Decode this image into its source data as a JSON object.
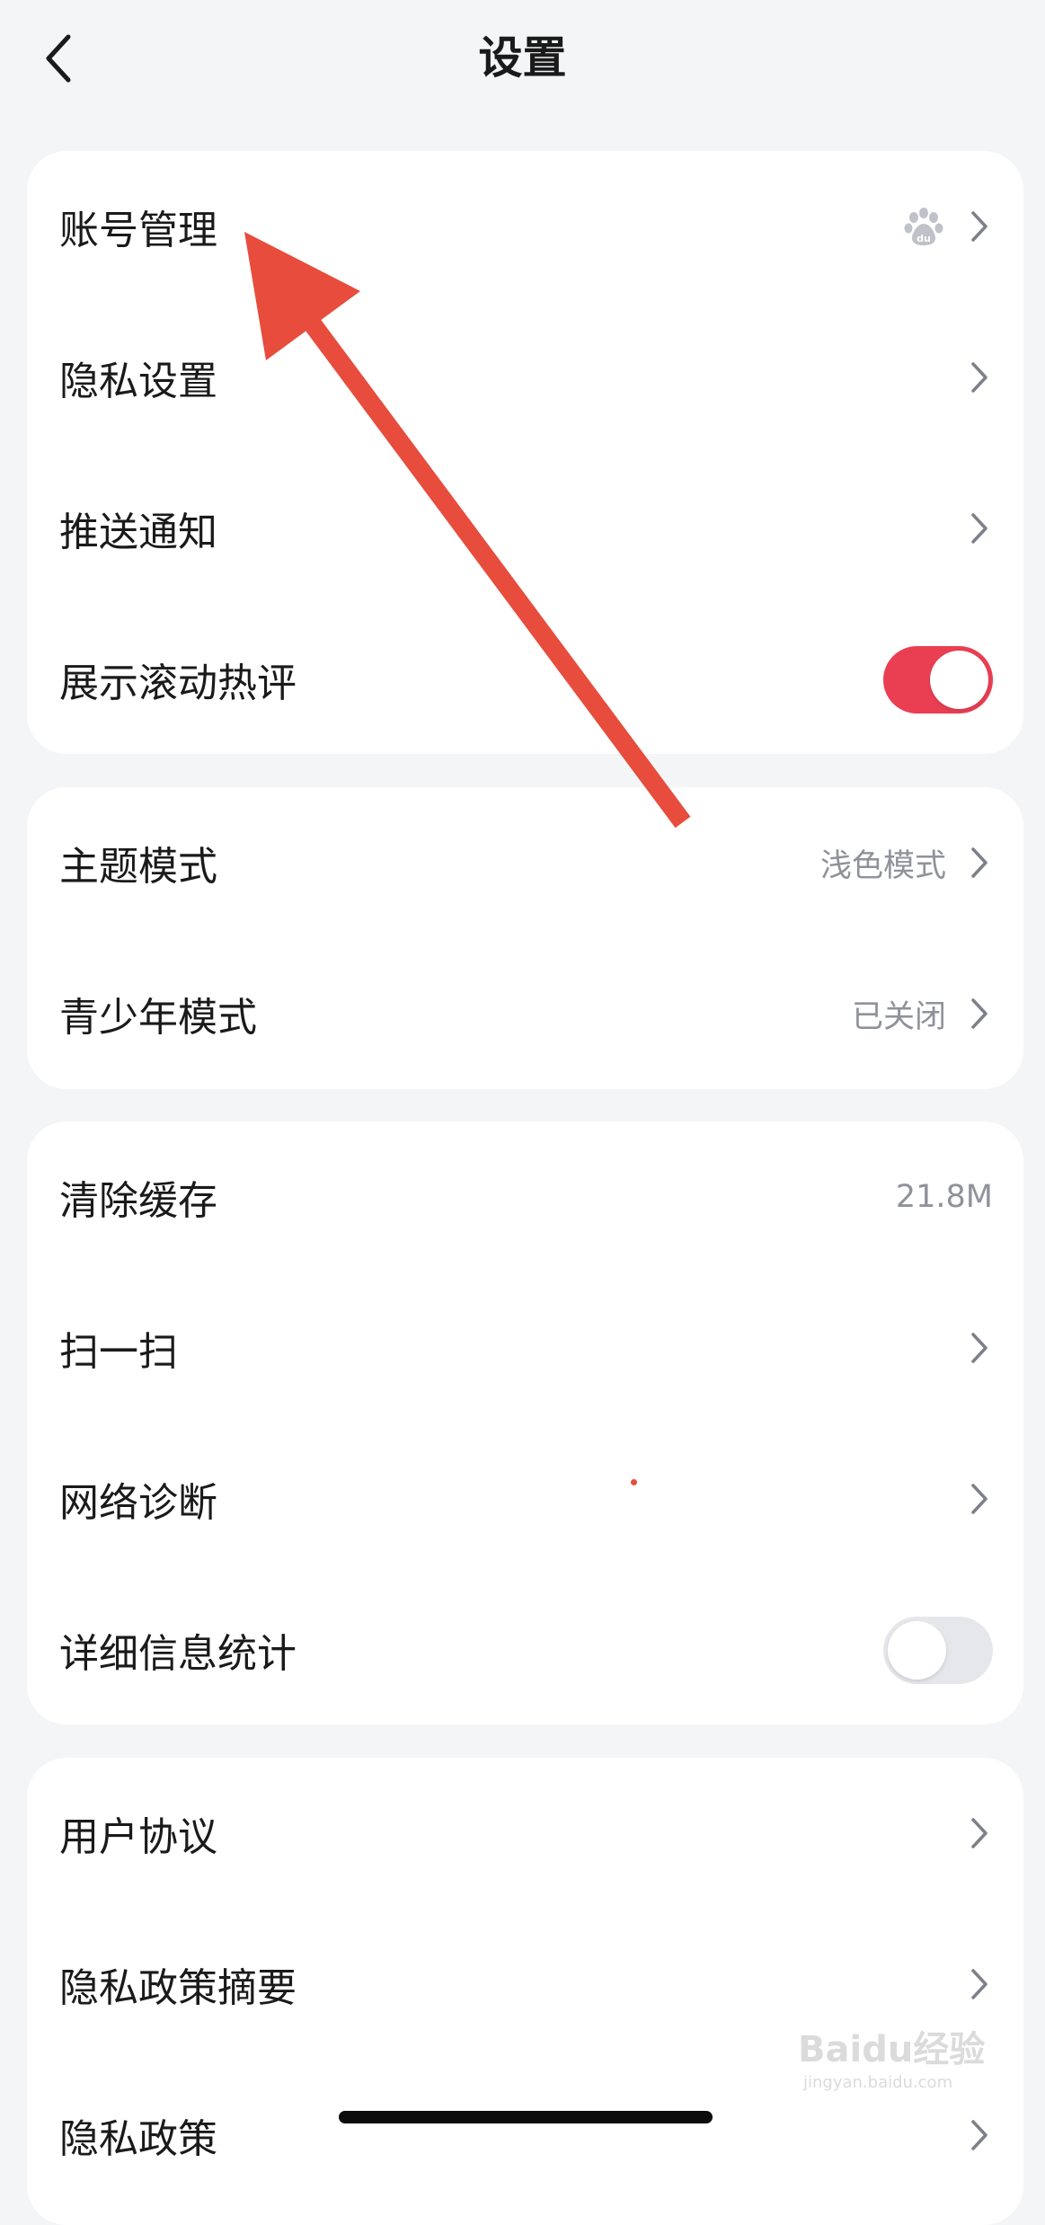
{
  "header": {
    "title": "设置"
  },
  "cards": [
    {
      "rows": [
        {
          "label": "账号管理",
          "value": "",
          "control": "chevron",
          "icon": "baidu-paw-icon"
        },
        {
          "label": "隐私设置",
          "value": "",
          "control": "chevron"
        },
        {
          "label": "推送通知",
          "value": "",
          "control": "chevron"
        },
        {
          "label": "展示滚动热评",
          "value": "",
          "control": "toggle",
          "toggle_on": true
        }
      ]
    },
    {
      "rows": [
        {
          "label": "主题模式",
          "value": "浅色模式",
          "control": "chevron"
        },
        {
          "label": "青少年模式",
          "value": "已关闭",
          "control": "chevron"
        }
      ]
    },
    {
      "rows": [
        {
          "label": "清除缓存",
          "value": "21.8M",
          "control": "none"
        },
        {
          "label": "扫一扫",
          "value": "",
          "control": "chevron"
        },
        {
          "label": "网络诊断",
          "value": "",
          "control": "chevron"
        },
        {
          "label": "详细信息统计",
          "value": "",
          "control": "toggle",
          "toggle_on": false
        }
      ]
    },
    {
      "rows": [
        {
          "label": "用户协议",
          "value": "",
          "control": "chevron"
        },
        {
          "label": "隐私政策摘要",
          "value": "",
          "control": "chevron"
        },
        {
          "label": "隐私政策",
          "value": "",
          "control": "chevron"
        }
      ]
    }
  ],
  "watermark": {
    "brand": "Baidu经验",
    "url": "jingyan.baidu.com"
  },
  "colors": {
    "accent": "#ea3f53",
    "annotation_arrow": "#e74c3c",
    "background": "#f4f5f7",
    "card": "#ffffff"
  }
}
